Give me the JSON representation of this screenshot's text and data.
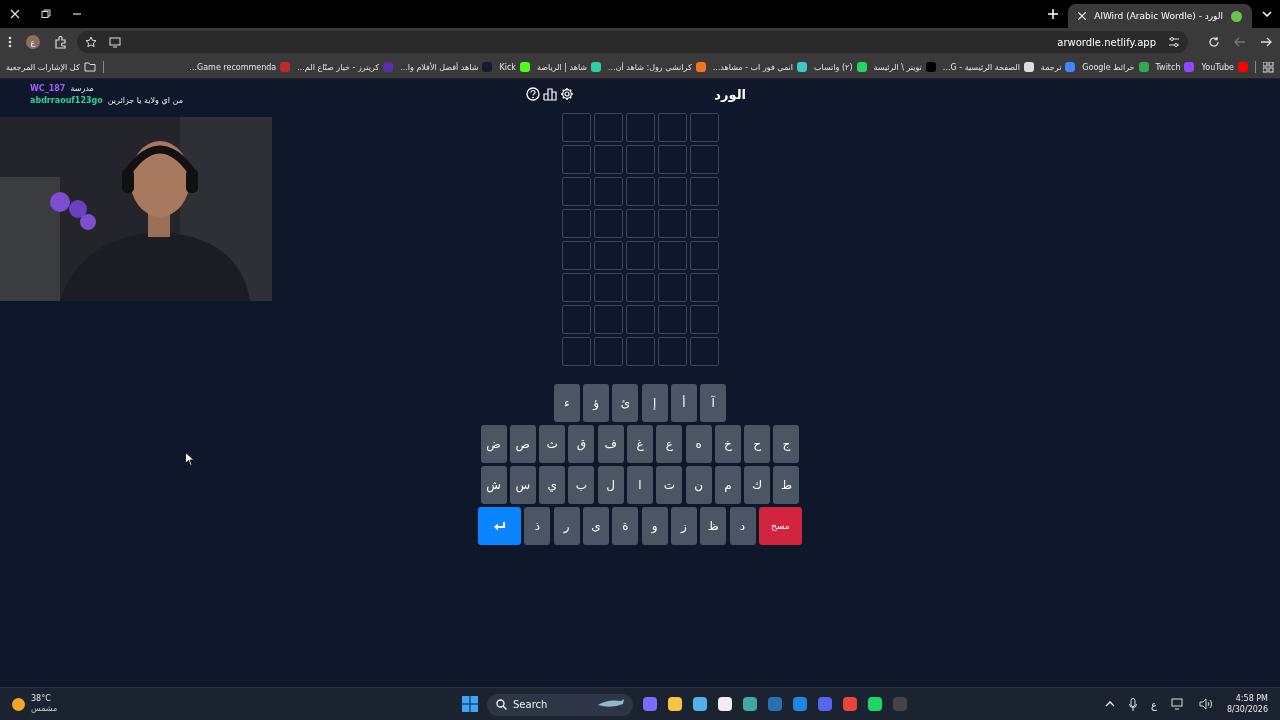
{
  "browser": {
    "tab": {
      "title": "الورد - AlWird (Arabic Wordle)",
      "selected": true
    },
    "profile": "ع",
    "url": "arwordle.netlify.app",
    "bookmarks": [
      {
        "label": "YouTube",
        "color": "#ff0000"
      },
      {
        "label": "Twitch",
        "color": "#9146ff"
      },
      {
        "label": "خرائط Google",
        "color": "#34a853"
      },
      {
        "label": "ترجمة",
        "color": "#4285f4"
      },
      {
        "label": "الصفحة الرئيسية - G...",
        "color": "#dddddd"
      },
      {
        "label": "تويتر \\ الرئيسة",
        "color": "#000000"
      },
      {
        "label": "(٢) واتساب",
        "color": "#25d366"
      },
      {
        "label": "انمي فور اب - مشاهد...",
        "color": "#3cc8c8"
      },
      {
        "label": "كرانشي رول: شاهد أن...",
        "color": "#f47521"
      },
      {
        "label": "شاهد | الرياضة",
        "color": "#2fd0a0"
      },
      {
        "label": "Kick",
        "color": "#53fc18"
      },
      {
        "label": "شاهد أفضل الأفلام وا...",
        "color": "#1a1a2e"
      },
      {
        "label": "كريترز - خيار صنّاع الم...",
        "color": "#5a2ea6"
      },
      {
        "label": "Game recommenda...",
        "color": "#c0282d"
      }
    ],
    "all_bookmarks": "كل الإشارات المرجعية"
  },
  "chat": [
    {
      "user": "WC_187",
      "color": "#a35cff",
      "message": "مدرسة"
    },
    {
      "user": "abdrraouf123go",
      "color": "#2fcf9a",
      "message": "من اي ولاية يا جزائرين"
    }
  ],
  "game": {
    "title": "الورد",
    "keyboard": [
      [
        {
          "kind": "letter",
          "label": "آ"
        },
        {
          "kind": "letter",
          "label": "أ"
        },
        {
          "kind": "letter",
          "label": "إ"
        },
        {
          "kind": "letter",
          "label": "ئ"
        },
        {
          "kind": "letter",
          "label": "ؤ"
        },
        {
          "kind": "letter",
          "label": "ء"
        }
      ],
      [
        {
          "kind": "letter",
          "label": "ج"
        },
        {
          "kind": "letter",
          "label": "ح"
        },
        {
          "kind": "letter",
          "label": "خ"
        },
        {
          "kind": "letter",
          "label": "ه"
        },
        {
          "kind": "letter",
          "label": "ع"
        },
        {
          "kind": "letter",
          "label": "غ"
        },
        {
          "kind": "letter",
          "label": "ف"
        },
        {
          "kind": "letter",
          "label": "ق"
        },
        {
          "kind": "letter",
          "label": "ث"
        },
        {
          "kind": "letter",
          "label": "ص"
        },
        {
          "kind": "letter",
          "label": "ض"
        }
      ],
      [
        {
          "kind": "letter",
          "label": "ط"
        },
        {
          "kind": "letter",
          "label": "ك"
        },
        {
          "kind": "letter",
          "label": "م"
        },
        {
          "kind": "letter",
          "label": "ن"
        },
        {
          "kind": "letter",
          "label": "ت"
        },
        {
          "kind": "letter",
          "label": "ا"
        },
        {
          "kind": "letter",
          "label": "ل"
        },
        {
          "kind": "letter",
          "label": "ب"
        },
        {
          "kind": "letter",
          "label": "ي"
        },
        {
          "kind": "letter",
          "label": "س"
        },
        {
          "kind": "letter",
          "label": "ش"
        }
      ],
      [
        {
          "kind": "delete",
          "label": "مسح"
        },
        {
          "kind": "letter",
          "label": "د"
        },
        {
          "kind": "letter",
          "label": "ظ"
        },
        {
          "kind": "letter",
          "label": "ز"
        },
        {
          "kind": "letter",
          "label": "و"
        },
        {
          "kind": "letter",
          "label": "ة"
        },
        {
          "kind": "letter",
          "label": "ى"
        },
        {
          "kind": "letter",
          "label": "ر"
        },
        {
          "kind": "letter",
          "label": "ذ"
        },
        {
          "kind": "enter"
        }
      ]
    ]
  },
  "taskbar": {
    "temperature": "38°C",
    "weather": "مشمس",
    "search": {
      "placeholder": "Search"
    },
    "language": "ع",
    "time": "4:58 PM",
    "date": "8/30/2026"
  }
}
